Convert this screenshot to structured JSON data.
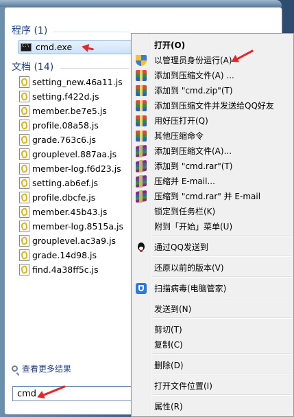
{
  "programs": {
    "header": "程序 (1)",
    "items": [
      {
        "label": "cmd.exe",
        "icon": "cmd-icon"
      }
    ]
  },
  "documents": {
    "header": "文档 (14)",
    "items": [
      {
        "label": "setting_new.46a11.js"
      },
      {
        "label": "setting.f422d.js"
      },
      {
        "label": "member.be7e5.js"
      },
      {
        "label": "profile.08a58.js"
      },
      {
        "label": "grade.763c6.js"
      },
      {
        "label": "grouplevel.887aa.js"
      },
      {
        "label": "member-log.f6d23.js"
      },
      {
        "label": "setting.ab6ef.js"
      },
      {
        "label": "profile.dbcfe.js"
      },
      {
        "label": "member.45b43.js"
      },
      {
        "label": "member-log.8515a.js"
      },
      {
        "label": "grouplevel.ac3a9.js"
      },
      {
        "label": "grade.14d98.js"
      },
      {
        "label": "find.4a38ff5c.js"
      }
    ]
  },
  "more_results": "查看更多结果",
  "search": {
    "value": "cmd"
  },
  "context_menu": {
    "items": [
      {
        "label": "打开(O)",
        "bold": true
      },
      {
        "label": "以管理员身份运行(A)",
        "icon": "uac-shield-icon"
      },
      {
        "label": "添加到压缩文件(A) ...",
        "icon": "360zip-icon"
      },
      {
        "label": "添加到 \"cmd.zip\"(T)",
        "icon": "360zip-icon"
      },
      {
        "label": "添加到压缩文件并发送给QQ好友",
        "icon": "360zip-icon"
      },
      {
        "label": "用好压打开(Q)",
        "icon": "360zip-icon"
      },
      {
        "label": "其他压缩命令",
        "icon": "360zip-icon"
      },
      {
        "label": "添加到压缩文件(A)...",
        "icon": "winrar-icon"
      },
      {
        "label": "添加到 \"cmd.rar\"(T)",
        "icon": "winrar-icon"
      },
      {
        "label": "压缩并 E-mail...",
        "icon": "winrar-icon"
      },
      {
        "label": "压缩到 \"cmd.rar\" 并 E-mail",
        "icon": "winrar-icon"
      },
      {
        "label": "锁定到任务栏(K)"
      },
      {
        "label": "附到「开始」菜单(U)"
      },
      {
        "label": "通过QQ发送到",
        "icon": "qq-penguin-icon"
      },
      {
        "label": "还原以前的版本(V)"
      },
      {
        "label": "扫描病毒(电脑管家)",
        "icon": "pc-manager-shield-icon"
      },
      {
        "label": "发送到(N)"
      },
      {
        "label": "剪切(T)"
      },
      {
        "label": "复制(C)"
      },
      {
        "label": "删除(D)"
      },
      {
        "label": "打开文件位置(I)"
      },
      {
        "label": "属性(R)"
      }
    ]
  },
  "colors": {
    "accent_text": "#1e3f8a",
    "annotation_arrow": "#e3272b"
  }
}
